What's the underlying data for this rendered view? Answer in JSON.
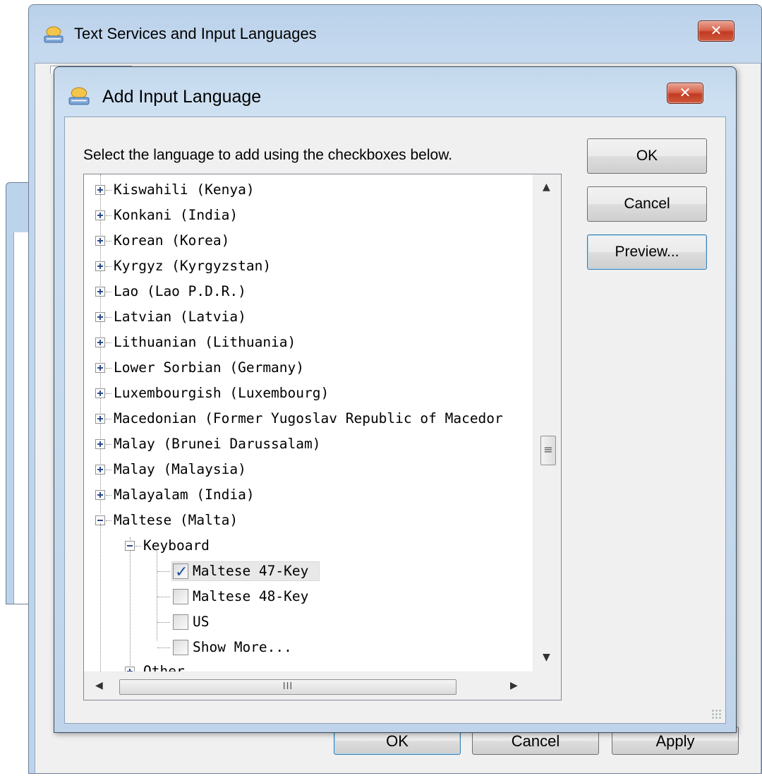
{
  "background_window": {
    "title": "Text Services and Input Languages",
    "close_label": "✕",
    "buttons": {
      "ok": "OK",
      "cancel": "Cancel",
      "apply": "Apply"
    }
  },
  "dialog": {
    "title": "Add Input Language",
    "close_label": "✕",
    "prompt": "Select the language to add using the checkboxes below.",
    "buttons": {
      "ok": "OK",
      "cancel": "Cancel",
      "preview": "Preview..."
    }
  },
  "tree": {
    "languages": [
      "Kiswahili (Kenya)",
      "Konkani (India)",
      "Korean (Korea)",
      "Kyrgyz (Kyrgyzstan)",
      "Lao (Lao P.D.R.)",
      "Latvian (Latvia)",
      "Lithuanian (Lithuania)",
      "Lower Sorbian (Germany)",
      "Luxembourgish (Luxembourg)",
      "Macedonian (Former Yugoslav Republic of Macedor",
      "Malay (Brunei Darussalam)",
      "Malay (Malaysia)",
      "Malayalam (India)"
    ],
    "expanded_language": "Maltese (Malta)",
    "keyboard_group": "Keyboard",
    "keyboards": [
      {
        "label": "Maltese 47-Key",
        "checked": true
      },
      {
        "label": "Maltese 48-Key",
        "checked": false
      },
      {
        "label": "US",
        "checked": false
      },
      {
        "label": "Show More...",
        "checked": false
      }
    ],
    "other_group": "Other"
  },
  "scrollbar": {
    "thumb_grip": "≡",
    "hthumb_grip": "III"
  },
  "icons": {
    "app": "keyboard-language-icon",
    "check": "checkmark-icon"
  }
}
